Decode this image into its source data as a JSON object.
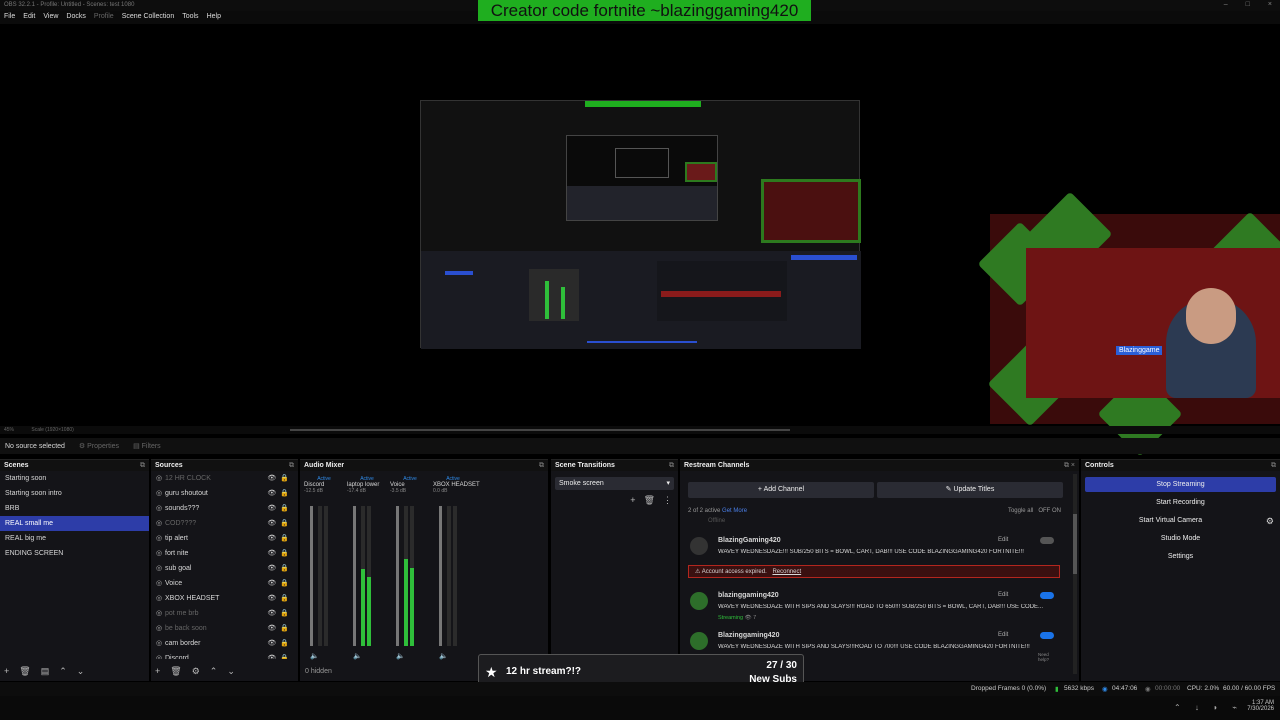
{
  "window": {
    "title": "OBS 32.2.1 - Profile: Untitled - Scenes: test 1080",
    "buttons": [
      "–",
      "□",
      "×"
    ]
  },
  "banner": {
    "text": "Creator code fortnite ~blazinggaming420"
  },
  "menu": {
    "items": [
      "File",
      "Edit",
      "View",
      "Docks",
      "Profile",
      "Scene Collection",
      "Tools",
      "Help"
    ]
  },
  "preview": {
    "overlay_label": "Blazinggame",
    "zoom": "45%",
    "scale": "Scale (1920×1080)"
  },
  "source_bar": {
    "status": "No source selected",
    "properties": "Properties",
    "filters": "Filters"
  },
  "scenes": {
    "title": "Scenes",
    "items": [
      "Starting soon",
      "Starting soon intro",
      "BRB",
      "REAL small me",
      "REAL big me",
      "ENDING SCREEN"
    ],
    "selected": 3
  },
  "sources": {
    "title": "Sources",
    "items": [
      {
        "name": "12 HR CLOCK",
        "dim": true
      },
      {
        "name": "guru shoutout",
        "dim": false
      },
      {
        "name": "sounds???",
        "dim": false
      },
      {
        "name": "COD????",
        "dim": true
      },
      {
        "name": "tip alert",
        "dim": false
      },
      {
        "name": "fort nite",
        "dim": false
      },
      {
        "name": "sub goal",
        "dim": false
      },
      {
        "name": "Voice",
        "dim": false
      },
      {
        "name": "XBOX HEADSET",
        "dim": false
      },
      {
        "name": "pot me brb",
        "dim": true
      },
      {
        "name": "be back soon",
        "dim": true
      },
      {
        "name": "cam border",
        "dim": false
      },
      {
        "name": "Discord",
        "dim": false
      }
    ]
  },
  "mixer": {
    "title": "Audio Mixer",
    "channels": [
      {
        "name": "Discord",
        "db": "-12.5 dB",
        "level": 0.0
      },
      {
        "name": "laptop lower",
        "db": "-17.4 dB",
        "level": 0.55
      },
      {
        "name": "Voice",
        "db": "-3.5 dB",
        "level": 0.62
      },
      {
        "name": "XBOX HEADSET",
        "db": "0.0 dB",
        "level": 0.0
      }
    ],
    "active": "Active",
    "hidden": "0 hidden"
  },
  "transitions": {
    "title": "Scene Transitions",
    "selected": "Smoke screen"
  },
  "restream": {
    "title": "Restream Channels",
    "add": "Add Channel",
    "update": "Update Titles",
    "active_count": "2 of 2 active",
    "get_more": "Get More",
    "toggle_all": "Toggle all",
    "off": "OFF",
    "on": "ON",
    "offline": "Offline",
    "channels": [
      {
        "name": "BlazingGaming420",
        "title": "WAVEY WEDNESDAZE!!! SUB/250 BITS = BOWL, CART, DAB!!! USE CODE BLAZINGGAMING420 FORTNITE!!!",
        "error": "Account access expired.",
        "reconnect": "Reconnect",
        "enabled": false,
        "edit": "Edit"
      },
      {
        "name": "blazinggaming420",
        "title": "WAVEY WEDNESDAZE WITH SIPS AND SLAYS!!! ROAD TO 650!!! SUB/250 BITS = BOWL, CART, DAB!!! USE CODE...",
        "status": "Streaming",
        "viewers": "7",
        "enabled": true,
        "edit": "Edit"
      },
      {
        "name": "Blazinggaming420",
        "title": "WAVEY WEDNESDAZE WITH SIPS AND SLAYS!!!ROAD TO 700!!! USE CODE BLAZINGGAMING420 FORTNITE!!!",
        "enabled": true,
        "edit": "Edit"
      }
    ],
    "help": "Need help?"
  },
  "controls": {
    "title": "Controls",
    "stop_streaming": "Stop Streaming",
    "start_recording": "Start Recording",
    "start_virtual_camera": "Start Virtual Camera",
    "studio_mode": "Studio Mode",
    "settings": "Settings"
  },
  "goal": {
    "title": "12 hr stream?!?",
    "count": "27 / 30",
    "label": "New Subs",
    "progress": 0.9
  },
  "status": {
    "dropped": "Dropped Frames 0 (0.0%)",
    "kbps": "5632 kbps",
    "stream_time": "04:47:06",
    "rec_time": "00:00:00",
    "cpu": "CPU: 2.0%",
    "fps": "60.00 / 60.00 FPS"
  },
  "taskbar": {
    "time": "1:37 AM",
    "date": "7/30/2026"
  },
  "colors": {
    "accent": "#2d3da8",
    "green": "#1fae1f",
    "error": "#b3261e",
    "toggle": "#1a73e8"
  }
}
